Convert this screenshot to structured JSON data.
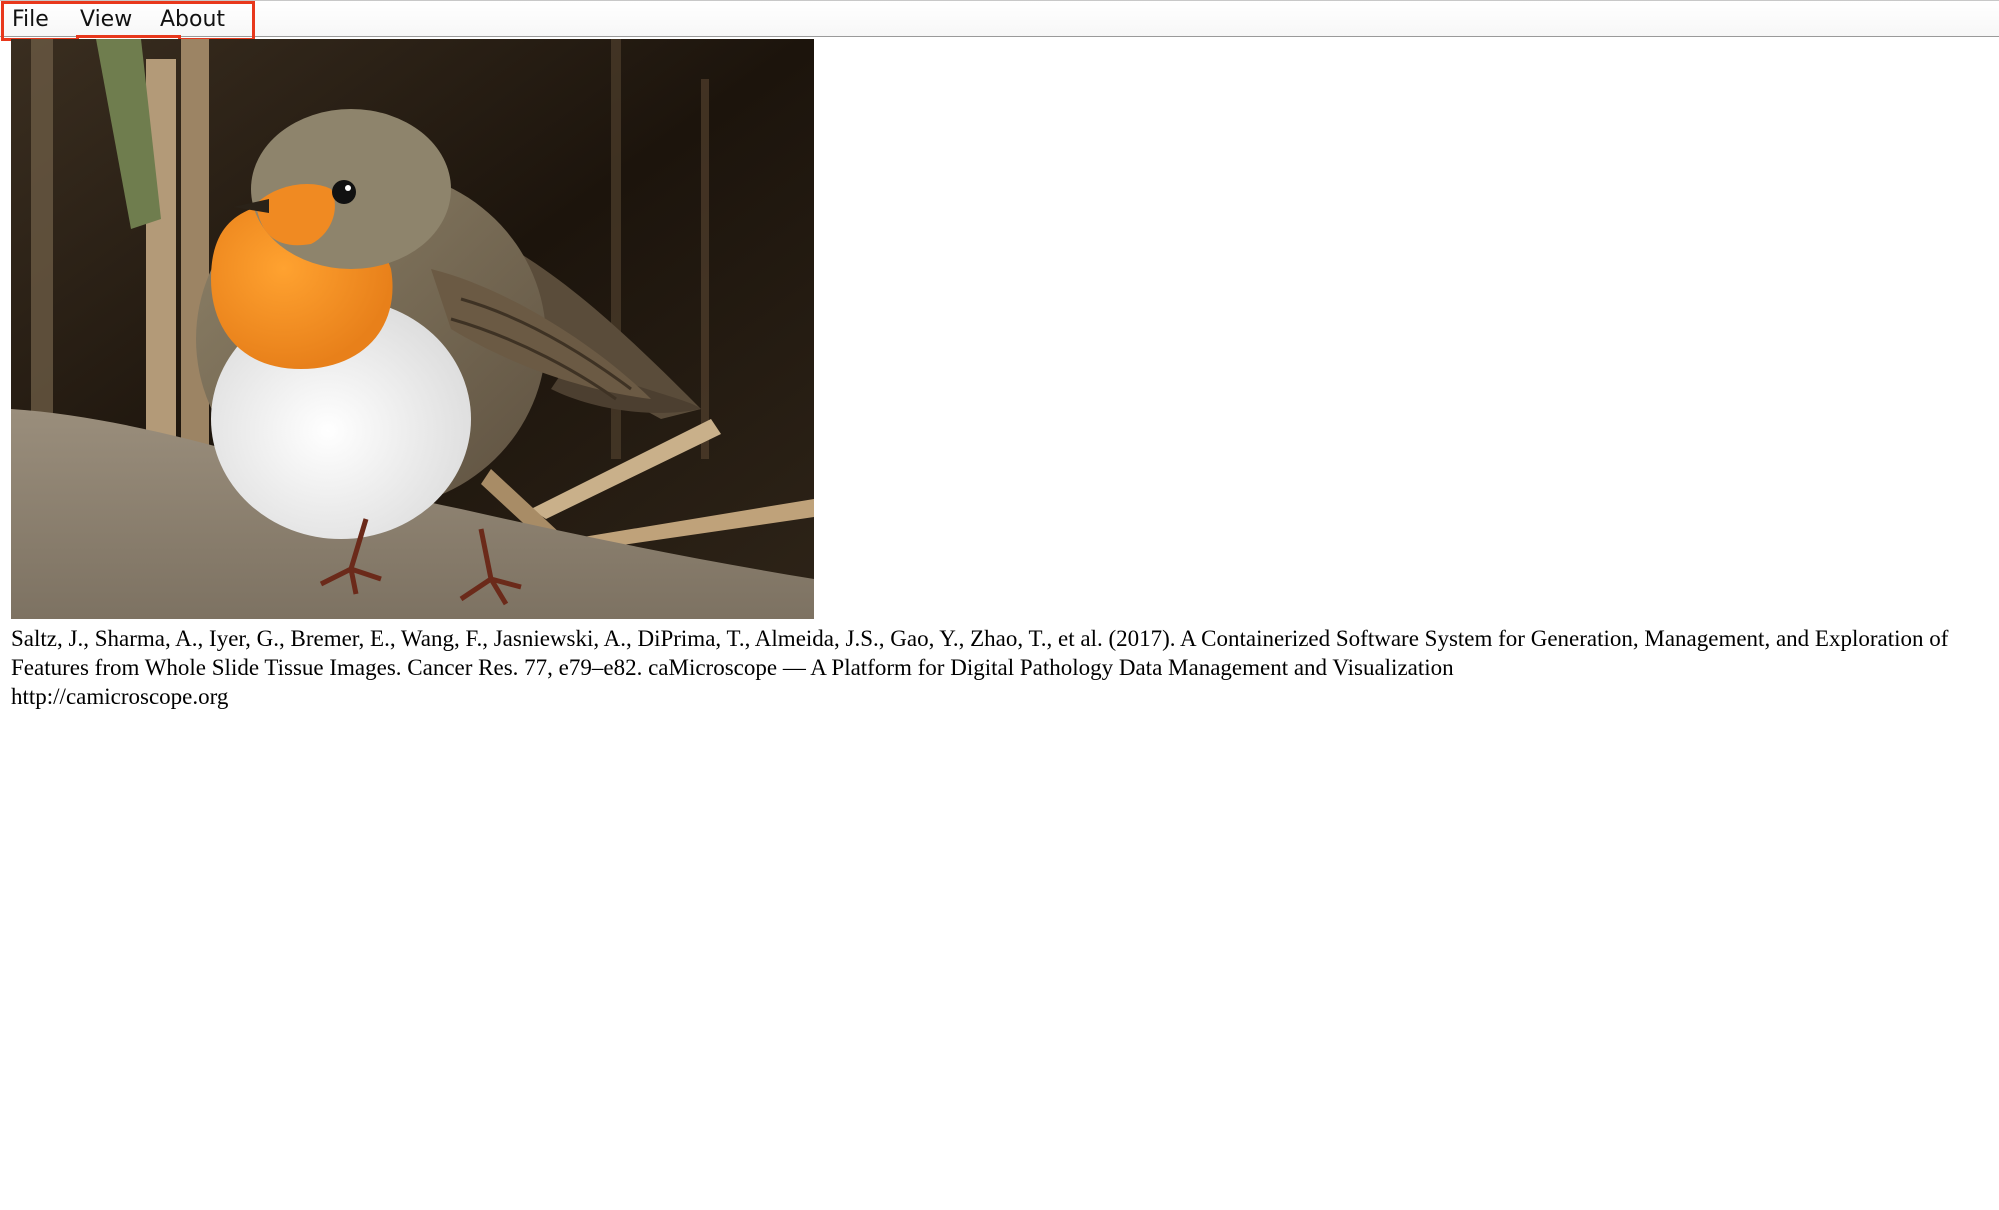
{
  "menubar": {
    "items": [
      {
        "label": "File"
      },
      {
        "label": "View"
      },
      {
        "label": "About"
      }
    ],
    "annotation_tag": "menu",
    "annotation_color": "#e8381c"
  },
  "main": {
    "image_subject": "robin-bird-photo",
    "citation": {
      "text": "Saltz, J., Sharma, A., Iyer, G., Bremer, E., Wang, F., Jasniewski, A., DiPrima, T., Almeida, J.S., Gao, Y., Zhao, T., et al. (2017). A Containerized Software System for Generation, Management, and Exploration of Features from Whole Slide Tissue Images. Cancer Res. 77, e79–e82. caMicroscope — A Platform for Digital Pathology Data Management and Visualization",
      "url": "http://camicroscope.org"
    }
  }
}
